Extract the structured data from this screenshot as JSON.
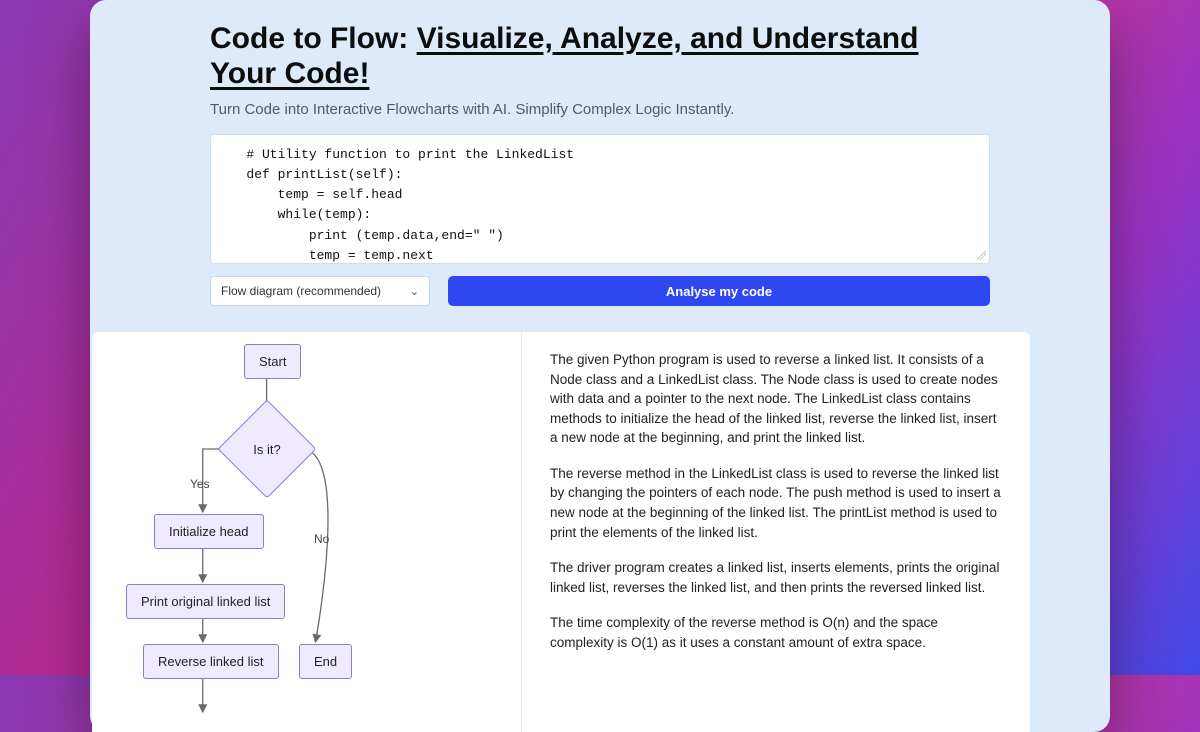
{
  "header": {
    "title_plain": "Code to Flow: ",
    "title_underlined": "Visualize, Analyze, and Understand Your Code!",
    "subtitle": "Turn Code into Interactive Flowcharts with AI. Simplify Complex Logic Instantly."
  },
  "code": {
    "lines": [
      "   # Utility function to print the LinkedList",
      "   def printList(self):",
      "       temp = self.head",
      "       while(temp):",
      "           print (temp.data,end=\" \")",
      "           temp = temp.next"
    ]
  },
  "controls": {
    "select_label": "Flow diagram (recommended)",
    "analyze_label": "Analyse my code"
  },
  "flowchart": {
    "start": "Start",
    "decision": "Is it?",
    "yes_label": "Yes",
    "no_label": "No",
    "init_head": "Initialize head",
    "print_original": "Print original linked list",
    "reverse": "Reverse linked list",
    "end": "End"
  },
  "explanation": {
    "p1": "The given Python program is used to reverse a linked list. It consists of a Node class and a LinkedList class. The Node class is used to create nodes with data and a pointer to the next node. The LinkedList class contains methods to initialize the head of the linked list, reverse the linked list, insert a new node at the beginning, and print the linked list.",
    "p2": "The reverse method in the LinkedList class is used to reverse the linked list by changing the pointers of each node. The push method is used to insert a new node at the beginning of the linked list. The printList method is used to print the elements of the linked list.",
    "p3": "The driver program creates a linked list, inserts elements, prints the original linked list, reverses the linked list, and then prints the reversed linked list.",
    "p4": "The time complexity of the reverse method is O(n) and the space complexity is O(1) as it uses a constant amount of extra space."
  }
}
